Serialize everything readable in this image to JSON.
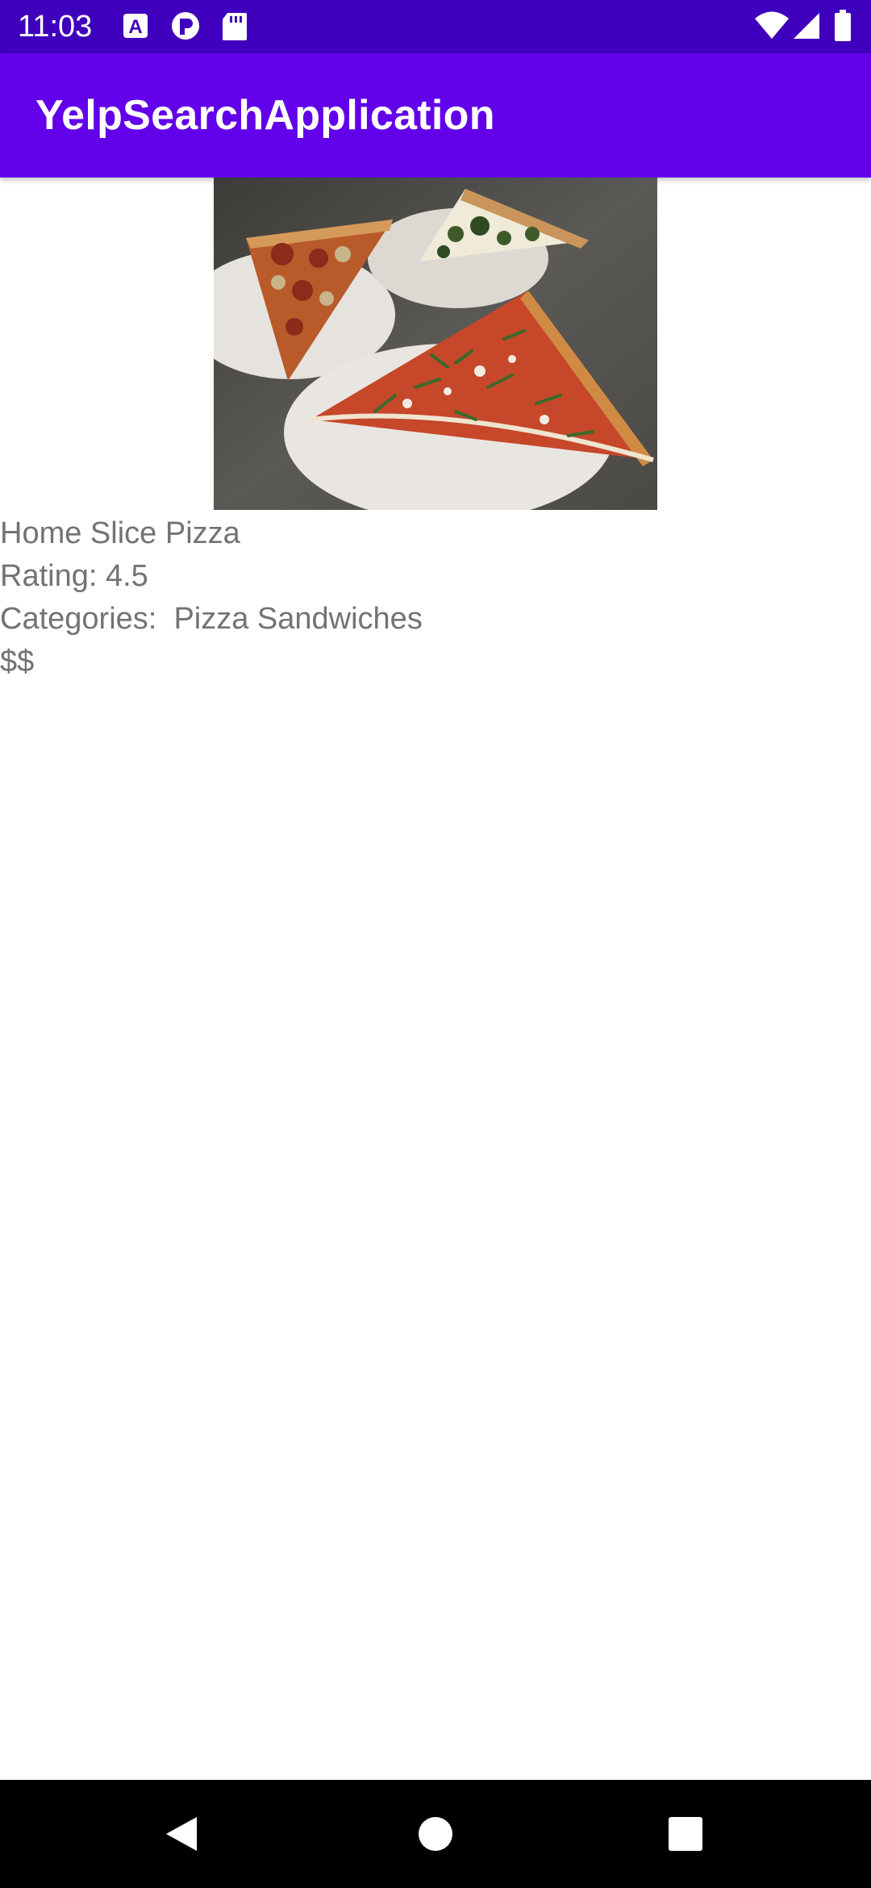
{
  "status_bar": {
    "time": "11:03",
    "color": "#3e00bd",
    "left_icons": [
      "font-a-icon",
      "radio-r-icon",
      "sd-card-icon"
    ],
    "right_icons": [
      "wifi-icon",
      "signal-icon",
      "battery-icon"
    ]
  },
  "app_bar": {
    "title": "YelpSearchApplication",
    "color": "#6200ea"
  },
  "business": {
    "image_icon": "pizza-photo",
    "name": "Home Slice Pizza",
    "rating_text": "Rating: 4.5",
    "categories_text": "Categories:  Pizza Sandwiches",
    "price": "$$"
  },
  "nav_bar": {
    "buttons": [
      "back-icon",
      "home-icon",
      "recents-icon"
    ]
  }
}
